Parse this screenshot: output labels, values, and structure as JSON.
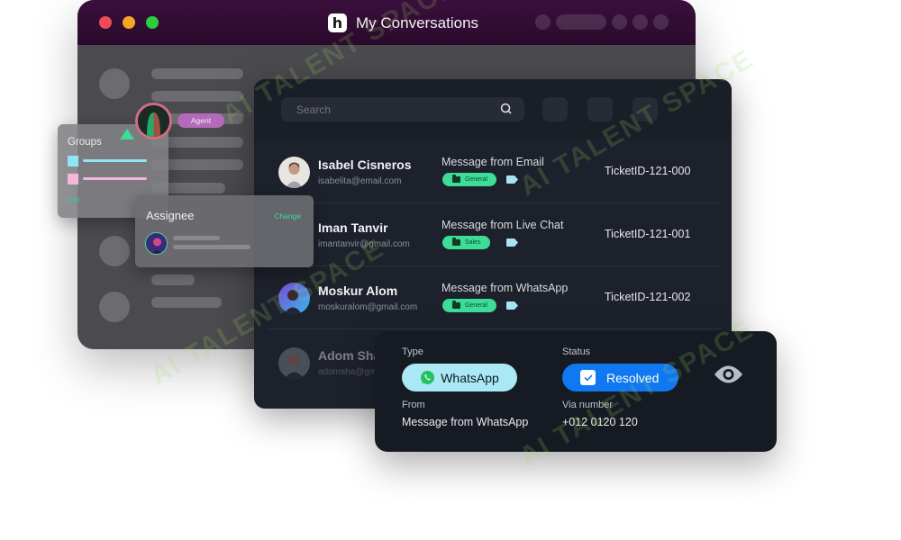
{
  "window": {
    "title": "My Conversations",
    "logo_letter": "h",
    "traffic_lights": [
      "close",
      "minimize",
      "maximize"
    ]
  },
  "search": {
    "placeholder": "Search",
    "icon": "search-icon"
  },
  "conversations": [
    {
      "name": "Isabel Cisneros",
      "email": "isabelita@email.com",
      "message": "Message from Email",
      "tag": "General",
      "ticket": "TicketID-121-000",
      "avatar_color": "#c9c4bd"
    },
    {
      "name": "Iman Tanvir",
      "email": "imantanvir@gmail.com",
      "message": "Message from Live Chat",
      "tag": "Sales",
      "ticket": "TicketID-121-001",
      "avatar_color": null
    },
    {
      "name": "Moskur Alom",
      "email": "moskuralom@gmail.com",
      "message": "Message from WhatsApp",
      "tag": "General",
      "ticket": "TicketID-121-002",
      "avatar_color": "#3a4aa8"
    },
    {
      "name": "Adom Sha",
      "email": "adomsha@gmail.com",
      "avatar_color": "#8a4a58"
    }
  ],
  "groups": {
    "title": "Groups",
    "items": [
      {
        "color": "#8fe4f6"
      },
      {
        "color": "#f5b6dc"
      }
    ],
    "edit_label": "Edit"
  },
  "agent": {
    "badge": "Agent"
  },
  "assignee": {
    "title": "Assignee",
    "change_label": "Change"
  },
  "detail": {
    "type_label": "Type",
    "type_value": "WhatsApp",
    "status_label": "Status",
    "status_value": "Resolved",
    "from_label": "From",
    "from_value": "Message from WhatsApp",
    "via_label": "Via number",
    "via_value": "+012 0120 120"
  },
  "colors": {
    "accent_green": "#3ddc97",
    "status_blue": "#1078f0",
    "type_cyan": "#a9e8f4",
    "agent_purple": "#b46abb",
    "titlebar_purple": "#3a0f3c"
  },
  "watermark": "AI TALENT SPACE"
}
